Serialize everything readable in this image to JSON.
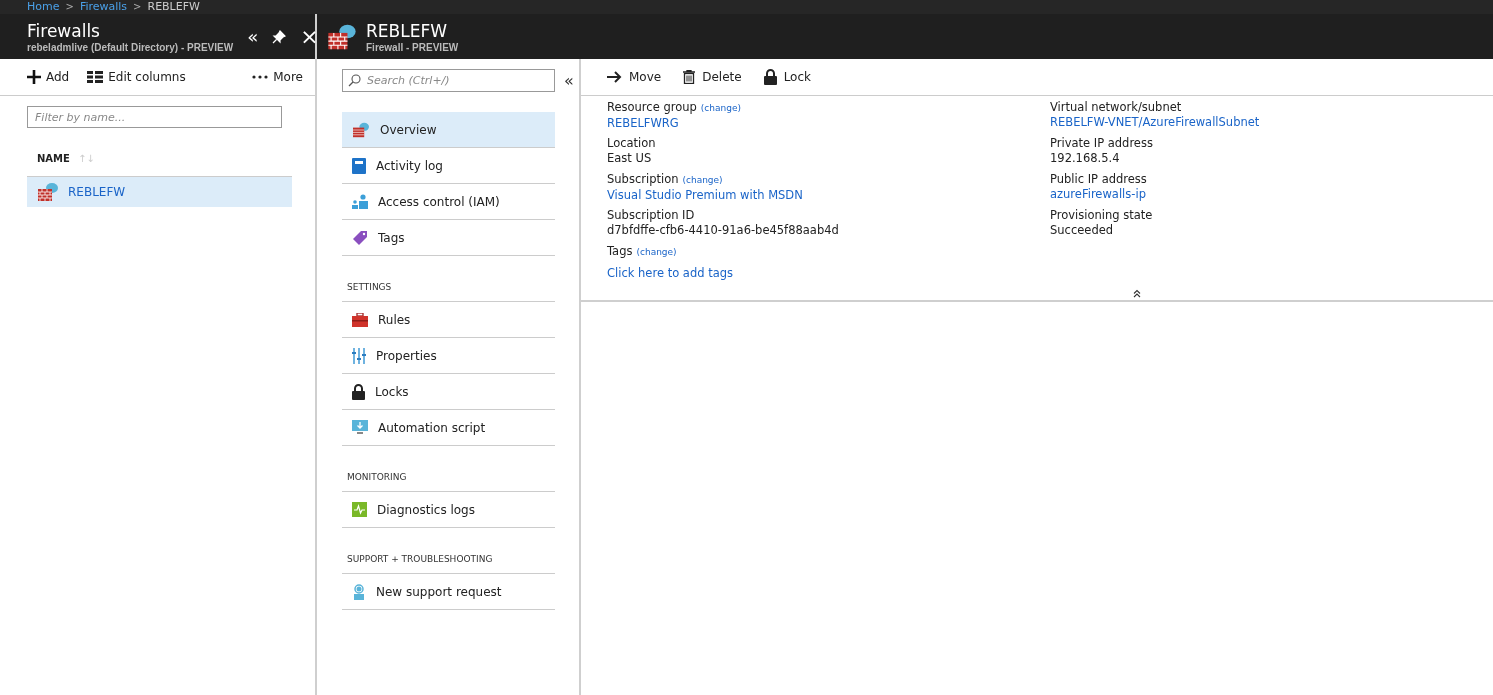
{
  "breadcrumb": [
    {
      "label": "Home",
      "link": true
    },
    {
      "label": "Firewalls",
      "link": true
    },
    {
      "label": "REBLEFW",
      "link": false
    }
  ],
  "breadcrumb_separator": ">",
  "left_blade": {
    "title": "Firewalls",
    "subtitle": "rebeladmlive (Default Directory) - PREVIEW",
    "header_buttons": [
      "«",
      "×"
    ],
    "toolbar": [
      {
        "kind": "add",
        "label": "Add"
      },
      {
        "kind": "columns",
        "label": "Edit columns"
      },
      {
        "kind": "more",
        "label": "More"
      }
    ],
    "filter": {
      "placeholder": "Filter by name..."
    },
    "column": "NAME",
    "sort_icon": "↑↓",
    "rows": [
      {
        "name": "REBLEFW",
        "selected": true
      }
    ]
  },
  "resource_blade": {
    "title": "REBLEFW",
    "subtitle": "Firewall - PREVIEW",
    "search": {
      "placeholder": "Search (Ctrl+/)"
    },
    "collapse": "«",
    "menu": [
      {
        "items": [
          {
            "kind": "firewall",
            "label": "Overview",
            "selected": true
          },
          {
            "kind": "book",
            "label": "Activity log",
            "selected": false
          },
          {
            "kind": "people",
            "label": "Access control (IAM)",
            "selected": false
          },
          {
            "kind": "tag",
            "label": "Tags",
            "selected": false
          }
        ]
      },
      {
        "heading": "SETTINGS",
        "items": [
          {
            "kind": "toolbox",
            "label": "Rules",
            "selected": false
          },
          {
            "kind": "sliders",
            "label": "Properties",
            "selected": false
          },
          {
            "kind": "lock",
            "label": "Locks",
            "selected": false
          },
          {
            "kind": "monitor",
            "label": "Automation script",
            "selected": false
          }
        ]
      },
      {
        "heading": "MONITORING",
        "items": [
          {
            "kind": "pulse",
            "label": "Diagnostics logs",
            "selected": false
          }
        ]
      },
      {
        "heading": "SUPPORT + TROUBLESHOOTING",
        "items": [
          {
            "kind": "support",
            "label": "New support request",
            "selected": false
          }
        ]
      }
    ],
    "commands": [
      {
        "kind": "move",
        "label": "Move"
      },
      {
        "kind": "delete",
        "label": "Delete"
      },
      {
        "kind": "lock",
        "label": "Lock"
      }
    ],
    "essentials_left": [
      {
        "label": "Resource group",
        "change": "(change)",
        "value": "REBELFWRG",
        "link": true
      },
      {
        "label": "Location",
        "value": "East US",
        "link": false
      },
      {
        "label": "Subscription",
        "change": "(change)",
        "value": "Visual Studio Premium with MSDN",
        "link": true
      },
      {
        "label": "Subscription ID",
        "value": "d7bfdffe-cfb6-4410-91a6-be45f88aab4d",
        "link": false
      }
    ],
    "essentials_right": [
      {
        "label": "Virtual network/subnet",
        "value": "REBELFW-VNET/AzureFirewallSubnet",
        "link": true
      },
      {
        "label": "Private IP address",
        "value": "192.168.5.4",
        "link": false
      },
      {
        "label": "Public IP address",
        "value": "azureFirewalls-ip",
        "link": true
      },
      {
        "label": "Provisioning state",
        "value": "Succeeded",
        "link": false
      }
    ],
    "tags": {
      "label": "Tags",
      "change": "(change)",
      "value": "Click here to add tags",
      "link": true
    }
  }
}
